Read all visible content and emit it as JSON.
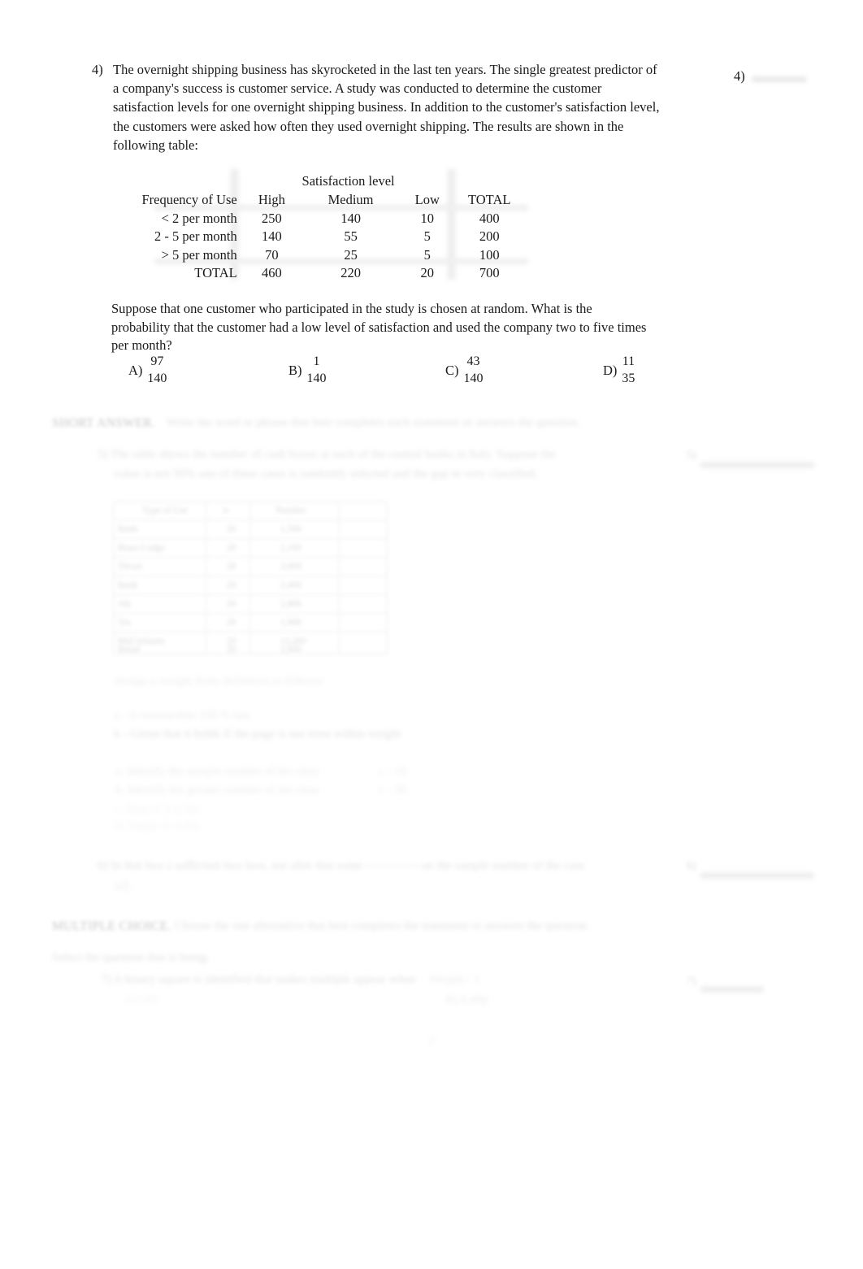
{
  "document": {
    "page_number": "2"
  },
  "question4": {
    "number": "4)",
    "margin_number": "4)",
    "body": "The overnight shipping business has skyrocketed in the last ten years. The single greatest predictor of a company's success is customer service. A study was conducted to determine the customer satisfaction levels for one overnight shipping business. In addition to the customer's satisfaction level, the customers were asked how often they used overnight shipping. The results are shown in the following table:",
    "prompt": "Suppose that one customer who participated in the study is chosen at random. What is the probability that the customer had a low level of satisfaction and used the company two to five times per month?",
    "table": {
      "span_header": "Satisfaction level",
      "headers": [
        "Frequency of Use",
        "High",
        "Medium",
        "Low",
        "TOTAL"
      ],
      "rows": [
        {
          "label": "< 2 per month",
          "high": "250",
          "medium": "140",
          "low": "10",
          "total": "400"
        },
        {
          "label": "2 -  5 per month",
          "high": "140",
          "medium": "55",
          "low": "5",
          "total": "200"
        },
        {
          "label": "> 5 per month",
          "high": "70",
          "medium": "25",
          "low": "5",
          "total": "100"
        },
        {
          "label": "TOTAL",
          "high": "460",
          "medium": "220",
          "low": "20",
          "total": "700"
        }
      ]
    },
    "choices": [
      {
        "label": "A)",
        "numerator": "97",
        "denominator": "140"
      },
      {
        "label": "B)",
        "numerator": "1",
        "denominator": "140"
      },
      {
        "label": "C)",
        "numerator": "43",
        "denominator": "140"
      },
      {
        "label": "D)",
        "numerator": "11",
        "denominator": "35"
      }
    ]
  },
  "degraded": {
    "note": "Content below question 4 is blurred/faded in the scan and is not legible.",
    "section_heading_1": "SHORT ANSWER.",
    "section_instruction_1": "Write the word or phrase that best completes each statement or answers the question.",
    "item5_line1": "5) The table shows the number of cash boxes at each of the central banks in Italy. Suppose the",
    "item5_line2": "value is not 50% one of these cases is randomly selected and the gap in very classified.",
    "item5_subnote": "Assign a weight from definition to follows:",
    "item5_bullet_1": "a - is measurable 100 % has",
    "item5_bullet_2": "b - Given that it holds if the page is not even within weight",
    "item5_sub_a": "a.       Identify the sample number of the class",
    "item5_sub_b": "b.       Identify the greater number of the class",
    "item5_sub_c": "c.       Note if it is  the",
    "item5_sub_d": "d.       Single N is  the",
    "item5_sub_val1": "c - 10",
    "item5_sub_val2": "c - 30",
    "item6_line": "6) In that box a sufficient box how, see       after that some ------------- on the sample number of the case",
    "item6_tail": "(d)",
    "section_heading_2": "MULTIPLE CHOICE.",
    "section_instruction_2": "Choose the one alternative that best completes the statement or answers the question.",
    "section_subnote": "Select the question that is being.",
    "item7_line": "7) A binary square  is identified that makes multiple appear when",
    "item7_mid": "Weight  /  1",
    "item7_sub1": "A) 140",
    "item7_sub2": "B) 0.40p",
    "margin_tag_5": "5)",
    "margin_tag_6": "6)",
    "margin_tag_7": "7)",
    "btable_header": [
      "Type of Use",
      "n",
      "Number"
    ],
    "btable_rows": [
      [
        "Bank",
        "20",
        "1,500"
      ],
      [
        "Brass Lodge",
        "20",
        "2,100"
      ],
      [
        "Thrust",
        "20",
        "3,000"
      ],
      [
        "Bank",
        "20",
        "2,400"
      ],
      [
        "Ale",
        "20",
        "2,800"
      ],
      [
        "Tin",
        "20",
        "1,900"
      ],
      [
        "Mid Atlantic",
        "20",
        "12,200"
      ],
      [
        "Retail",
        "20",
        "2,600"
      ]
    ]
  }
}
